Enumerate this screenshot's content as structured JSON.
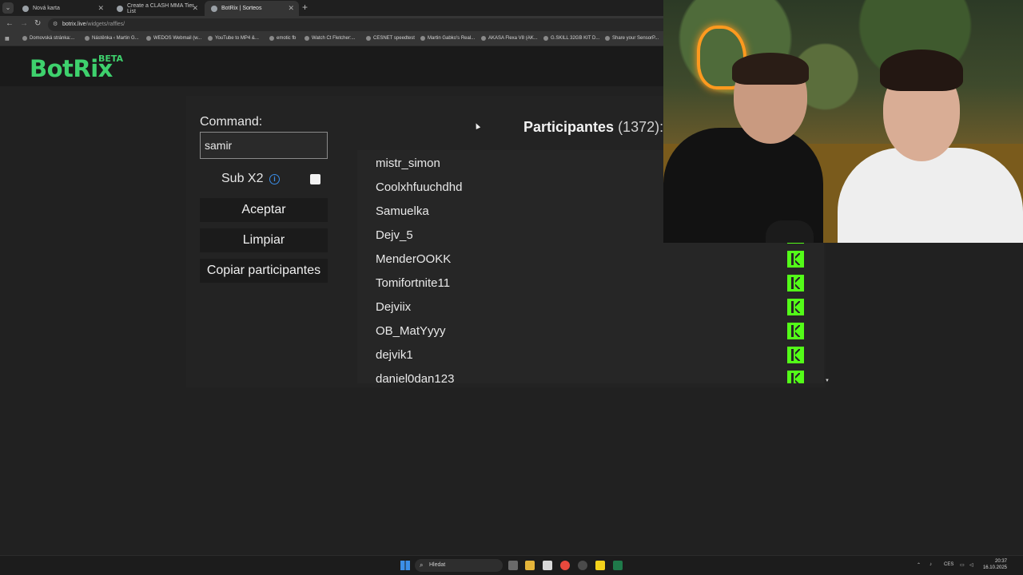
{
  "browser": {
    "tabs": [
      {
        "label": "Nová karta"
      },
      {
        "label": "Create a CLASH MMA Tier List"
      },
      {
        "label": "BotRix | Sorteos"
      }
    ],
    "url_host": "botrix.live",
    "url_path": "/widgets/raffles/",
    "bookmarks": [
      "Domovská stránka:...",
      "Nástěnka ‹ Martin G...",
      "WEDOS Webmail (w...",
      "YouTube to MP4 &...",
      "emotic fb",
      "Watch Ct Fletcher:...",
      "CESNET speedtest",
      "Martin Gabko's Real...",
      "AKASA Flexa V8 (AK...",
      "G.SKILL 32GB KIT D...",
      "Share your SensorP..."
    ]
  },
  "site": {
    "logo": "BotRix",
    "logo_badge": "BETA"
  },
  "raffle": {
    "command_label": "Command:",
    "command_value": "samir",
    "sub_label": "Sub X2",
    "sub_checked": false,
    "accept_label": "Aceptar",
    "clear_label": "Limpiar",
    "copy_label": "Copiar participantes",
    "participants_label": "Participantes",
    "participants_count": "(1372):",
    "participants": [
      {
        "name": "mistr_simon"
      },
      {
        "name": "Coolxhfuuchdhd"
      },
      {
        "name": "Samuelka"
      },
      {
        "name": "Dejv_5"
      },
      {
        "name": "MenderOOKK"
      },
      {
        "name": "Tomifortnite11"
      },
      {
        "name": "Dejviix"
      },
      {
        "name": "OB_MatYyyy"
      },
      {
        "name": "dejvik1"
      },
      {
        "name": "daniel0dan123"
      }
    ]
  },
  "taskbar": {
    "search_placeholder": "Hledat",
    "language": "CES",
    "time": "20:37",
    "date": "16.10.2025"
  },
  "colors": {
    "brand_green": "#3ed16d",
    "kick_green": "#53fc18",
    "info_blue": "#3b8ee8"
  }
}
